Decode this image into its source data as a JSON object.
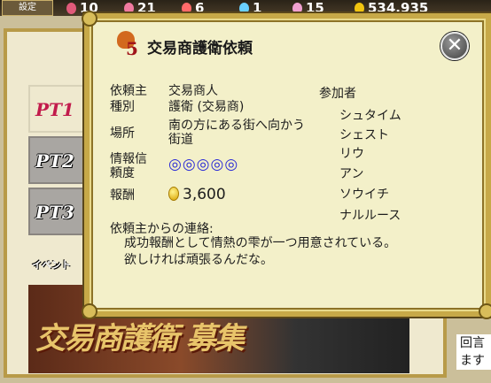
{
  "topbar": {
    "logo_label": "設定",
    "resources": [
      {
        "name": "resource-1",
        "value": "10",
        "icon": "flask-icon",
        "color": "#e05a7a"
      },
      {
        "name": "resource-2",
        "value": "21",
        "icon": "potion-icon",
        "color": "#f07aa0"
      },
      {
        "name": "resource-3",
        "value": "6",
        "icon": "gem-icon",
        "color": "#ff6a6a"
      },
      {
        "name": "resource-4",
        "value": "1",
        "icon": "ticket-icon",
        "color": "#6ad0ff"
      },
      {
        "name": "resource-5",
        "value": "15",
        "icon": "cat-icon",
        "color": "#f0a0d0"
      },
      {
        "name": "gold",
        "value": "534,935",
        "icon": "coin-icon",
        "color": "#f1c40f"
      }
    ]
  },
  "background": {
    "party_tabs": [
      "PT1",
      "PT2",
      "PT3"
    ],
    "event_label": "イベント",
    "banner_text": "交易商護衛 募集",
    "side_text": "回言\nます"
  },
  "quest": {
    "rank": "5",
    "title": "交易商護衛依頼",
    "fields": {
      "client_label": "依頼主",
      "client_value": "交易商人",
      "type_label": "種別",
      "type_value": "護衛 (交易商)",
      "location_label": "場所",
      "location_value": "南の方にある街へ向かう街道",
      "reliability_label": "情報信頼度",
      "reliability_value": "◎◎◎◎◎",
      "reward_label": "報酬",
      "reward_value": "3,600"
    },
    "participants_label": "参加者",
    "participants": [
      "シュタイム",
      "シェスト",
      "リウ",
      "アン",
      "ソウイチ",
      "ナルルース"
    ],
    "message_label": "依頼主からの連絡:",
    "message": "成功報酬として情熱の雫が一つ用意されている。欲しければ頑張るんだな。"
  },
  "colors": {
    "frame": "#c7a948",
    "panel": "#f3f0c9",
    "reliability": "#2a2ad6"
  }
}
